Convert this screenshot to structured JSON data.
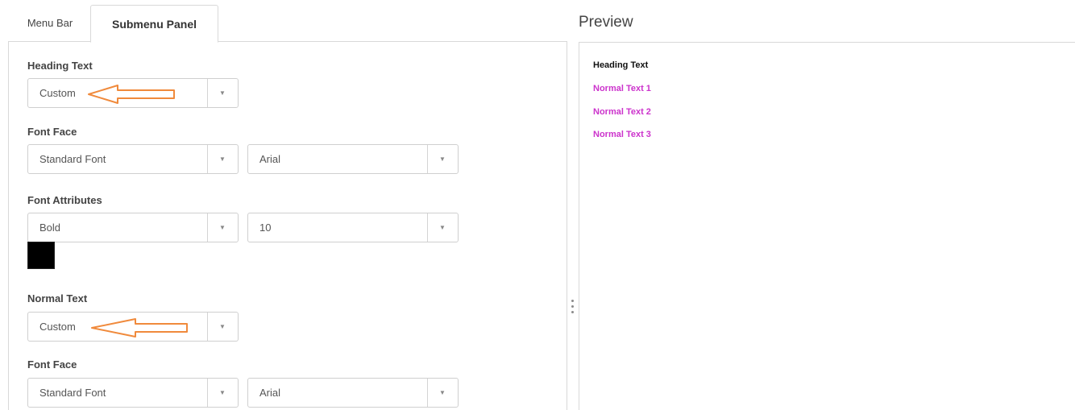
{
  "tabs": {
    "menu_bar": "Menu Bar",
    "submenu_panel": "Submenu Panel"
  },
  "heading_section": {
    "label": "Heading Text",
    "style_select": "Custom",
    "font_face_label": "Font Face",
    "font_type_select": "Standard Font",
    "font_family_select": "Arial",
    "font_attributes_label": "Font Attributes",
    "weight_select": "Bold",
    "size_select": "10",
    "color": "#000000"
  },
  "normal_section": {
    "label": "Normal Text",
    "style_select": "Custom",
    "font_face_label": "Font Face",
    "font_type_select": "Standard Font",
    "font_family_select": "Arial"
  },
  "preview": {
    "title": "Preview",
    "heading": "Heading Text",
    "items": [
      "Normal Text 1",
      "Normal Text 2",
      "Normal Text 3"
    ],
    "item_color": "#cc33cc"
  },
  "annotation": {
    "arrow_color": "#f08a3c",
    "icon": "left-arrow-icon"
  },
  "icons": {
    "caret": "▼"
  }
}
